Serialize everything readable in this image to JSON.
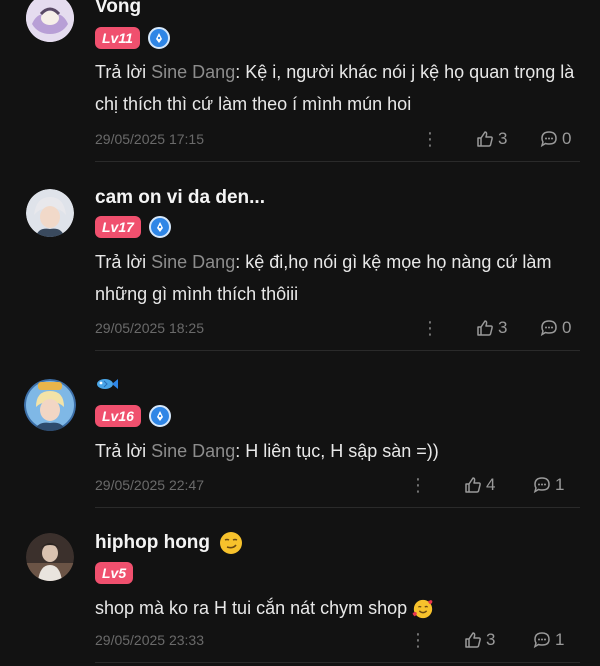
{
  "comments": [
    {
      "username": "Vong",
      "level": "Lv11",
      "has_pen_badge": true,
      "reply_prefix": "Trả lời ",
      "reply_to": "Sine Dang",
      "text": ": Kệ i, người khác nói j kệ họ quan trọng là chị thích thì cứ làm theo í mình mún hoi",
      "timestamp": "29/05/2025 17:15",
      "likes": "3",
      "replies": "0"
    },
    {
      "username": "cam on vi da den...",
      "level": "Lv17",
      "has_pen_badge": true,
      "reply_prefix": "Trả lời ",
      "reply_to": "Sine Dang",
      "text": ": kệ đi,họ nói gì kệ mọe họ nàng cứ làm những gì mình thích thôiii",
      "timestamp": "29/05/2025 18:25",
      "likes": "3",
      "replies": "0"
    },
    {
      "username": "",
      "username_icon": "fish-icon",
      "level": "Lv16",
      "has_pen_badge": true,
      "reply_prefix": "Trả lời ",
      "reply_to": "Sine Dang",
      "text": ": H liên tục, H sập sàn =))",
      "timestamp": "29/05/2025 22:47",
      "likes": "4",
      "replies": "1"
    },
    {
      "username": "hiphop hong",
      "username_icon": "smirk-emoji",
      "level": "Lv5",
      "has_pen_badge": false,
      "text": "shop mà ko ra H tui cắn nát chym shop",
      "text_icon": "smiling-hearts-emoji",
      "timestamp": "29/05/2025 23:33",
      "likes": "3",
      "replies": "1"
    }
  ],
  "colors": {
    "background": "#121212",
    "level_badge": "#f0506e",
    "pen_badge": "#2f86e6",
    "reply_name": "#8c8c8c",
    "timestamp": "#6a6a6a"
  }
}
